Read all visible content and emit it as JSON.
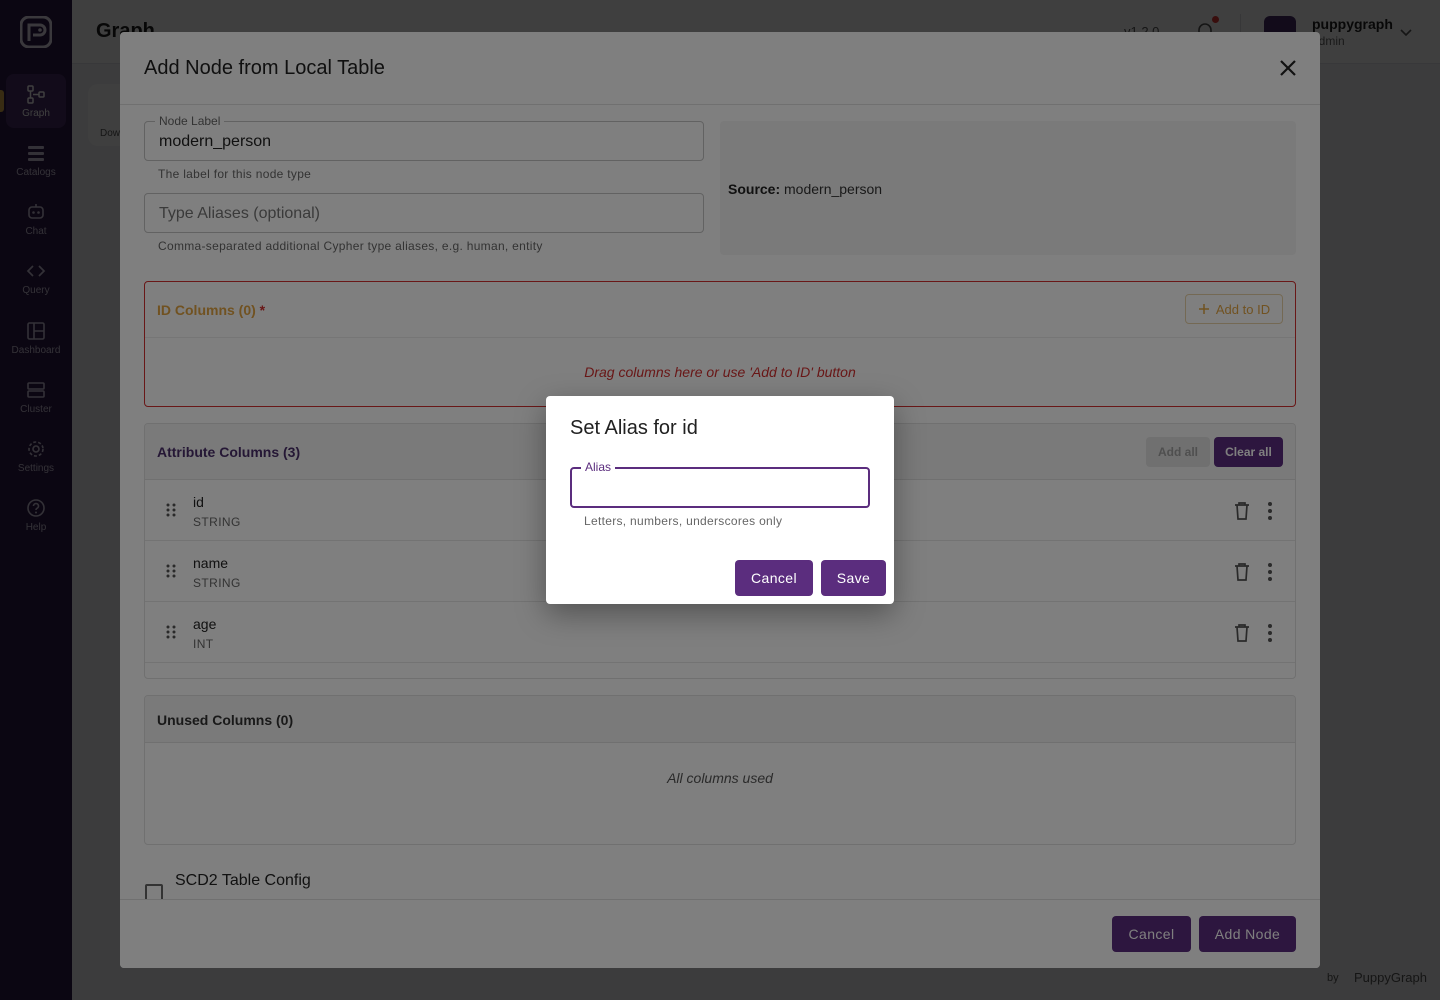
{
  "app": {
    "page_title": "Graph",
    "version": "v1.2.0",
    "user": {
      "name": "puppygraph",
      "role": "admin"
    },
    "footer_by": "by",
    "footer_brand": "PuppyGraph",
    "bg_card_text": "Dow"
  },
  "sidebar": {
    "items": [
      {
        "label": "Graph",
        "icon": "graph-icon",
        "active": true
      },
      {
        "label": "Catalogs",
        "icon": "catalog-icon"
      },
      {
        "label": "Chat",
        "icon": "chat-icon"
      },
      {
        "label": "Query",
        "icon": "code-icon"
      },
      {
        "label": "Dashboard",
        "icon": "dashboard-icon"
      },
      {
        "label": "Cluster",
        "icon": "cluster-icon"
      },
      {
        "label": "Settings",
        "icon": "gear-icon"
      },
      {
        "label": "Help",
        "icon": "help-icon"
      }
    ]
  },
  "main_dialog": {
    "title": "Add Node from Local Table",
    "node_label": {
      "label": "Node Label",
      "value": "modern_person",
      "helper": "The label for this node type"
    },
    "type_aliases": {
      "placeholder": "Type Aliases (optional)",
      "value": "",
      "helper": "Comma-separated additional Cypher type aliases, e.g. human, entity"
    },
    "source": {
      "label": "Source:",
      "value": "modern_person"
    },
    "id_columns": {
      "title": "ID Columns (0)",
      "required_mark": "*",
      "add_button": "Add to ID",
      "empty_text": "Drag columns here or use 'Add to ID' button"
    },
    "attribute_columns": {
      "title": "Attribute Columns (3)",
      "add_all": "Add all",
      "clear_all": "Clear all",
      "rows": [
        {
          "name": "id",
          "type": "STRING"
        },
        {
          "name": "name",
          "type": "STRING"
        },
        {
          "name": "age",
          "type": "INT"
        }
      ]
    },
    "unused_columns": {
      "title": "Unused Columns (0)",
      "empty_text": "All columns used"
    },
    "scd2": {
      "label": "SCD2 Table Config",
      "checked": false
    },
    "footer": {
      "cancel": "Cancel",
      "add": "Add Node"
    }
  },
  "alias_dialog": {
    "title": "Set Alias for id",
    "field_label": "Alias",
    "value": "",
    "helper": "Letters, numbers, underscores only",
    "cancel": "Cancel",
    "save": "Save"
  },
  "colors": {
    "sidebar_bg": "#2f1a4a",
    "primary": "#5b2d7e",
    "id_accent": "#e2a543",
    "error": "#d32f2f"
  }
}
